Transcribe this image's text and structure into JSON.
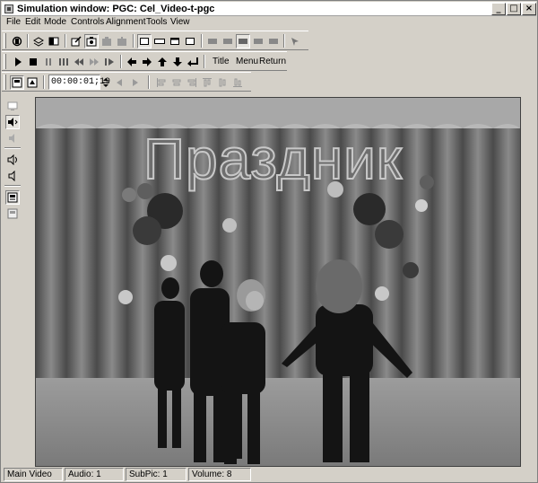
{
  "window": {
    "title": "Simulation window: PGC: Cel_Video-t-pgc",
    "minimize": "_",
    "maximize": "□",
    "close": "×"
  },
  "menu": [
    "File",
    "Edit",
    "Mode",
    "Controls",
    "Alignment",
    "Tools",
    "View"
  ],
  "controls": {
    "title_label": "Title",
    "menu_label": "Menu",
    "return_label": "Return"
  },
  "timecode": "00:00:01;19",
  "video": {
    "overlay_text": "Праздник"
  },
  "status": {
    "stream": "Main Video",
    "audio": "Audio: 1",
    "subpic": "SubPic: 1",
    "volume": "Volume: 8"
  },
  "colors": {
    "chrome": "#d4d0c8",
    "title_bar": "#ffffff"
  }
}
